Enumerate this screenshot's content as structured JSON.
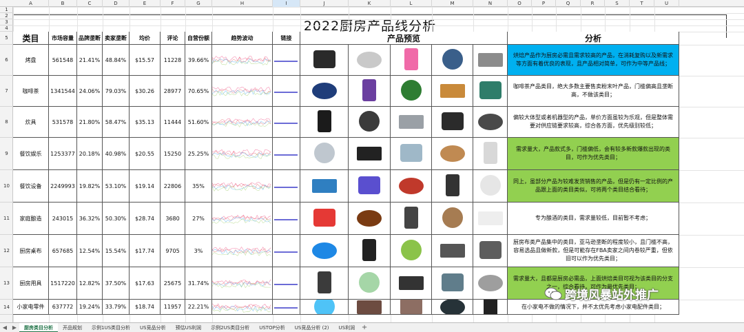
{
  "title": "2022厨房产品线分析",
  "column_letters": [
    "A",
    "B",
    "C",
    "D",
    "E",
    "F",
    "G",
    "H",
    "I",
    "J",
    "K",
    "L",
    "M",
    "N",
    "O",
    "P",
    "Q",
    "R",
    "S",
    "T",
    "U"
  ],
  "selected_column": "I",
  "row_numbers": [
    "1",
    "2",
    "3",
    "4",
    "5",
    "6",
    "7",
    "8",
    "9",
    "10",
    "11",
    "12",
    "13",
    "14"
  ],
  "headers": {
    "category": "类目",
    "market": "市场容量",
    "brand": "品牌垄断",
    "seller": "卖家垄断",
    "price": "均价",
    "reviews": "评论",
    "own_share": "自营份额",
    "trend": "趋势波动",
    "link": "链接",
    "preview": "产品预览",
    "analysis": "分析"
  },
  "rows": [
    {
      "category": "烤盘",
      "market": "561548",
      "brand": "21.41%",
      "seller": "48.84%",
      "price": "$15.57",
      "reviews": "11228",
      "own_share": "39.66%",
      "analysis": "烘焙产品作为厨房必需且需求较高的产品，在消耗复购以及新需求等方面有着优良的表现，且产品相对简单，可作为中等产品线；",
      "analysis_color": "blue"
    },
    {
      "category": "咖啡茶",
      "market": "1341544",
      "brand": "24.06%",
      "seller": "79.03%",
      "price": "$30.26",
      "reviews": "28977",
      "own_share": "70.65%",
      "analysis": "咖啡茶产品类目，绝大多数主要售卖粉末叶产品，门槛偏高且垄断高，不做该类目；",
      "analysis_color": "none"
    },
    {
      "category": "炊具",
      "market": "531578",
      "brand": "21.80%",
      "seller": "58.47%",
      "price": "$35.13",
      "reviews": "11444",
      "own_share": "51.60%",
      "analysis": "偏较大体型或者机器型的产品，单价方面虽较为乐观，但是整体需要对供应链要求较高，综合各方面，优先级别较低；",
      "analysis_color": "none"
    },
    {
      "category": "餐饮娱乐",
      "market": "1253377",
      "brand": "20.18%",
      "seller": "40.98%",
      "price": "$20.55",
      "reviews": "15250",
      "own_share": "25.25%",
      "analysis": "需求量大，产品款式多，门槛偏低，会有较多新款爆款出现的类目，可作为优先类目；",
      "analysis_color": "green"
    },
    {
      "category": "餐饮设备",
      "market": "2249993",
      "brand": "19.82%",
      "seller": "53.10%",
      "price": "$19.14",
      "reviews": "22806",
      "own_share": "35%",
      "analysis": "同上，虽部分产品为较难发货销售的产品，但是仍有一定比例的产品跟上面的类目类似，可将两个类目结合看待；",
      "analysis_color": "green"
    },
    {
      "category": "家庭酿造",
      "market": "243015",
      "brand": "36.32%",
      "seller": "50.30%",
      "price": "$28.74",
      "reviews": "3680",
      "own_share": "27%",
      "analysis": "专为酿酒的类目，需求量较低，目前暂不考虑；",
      "analysis_color": "none"
    },
    {
      "category": "厨房桌布",
      "market": "657685",
      "brand": "12.54%",
      "seller": "15.54%",
      "price": "$17.74",
      "reviews": "9705",
      "own_share": "3%",
      "analysis": "厨房布类产品集中的类目，亚马逊垄断的程度较小，且门槛不高，容易选品且做新款，但是可能存在FBA卖家之间内卷较严重，但依旧可以作为优先类目；",
      "analysis_color": "none"
    },
    {
      "category": "厨房用具",
      "market": "1517220",
      "brand": "12.82%",
      "seller": "37.50%",
      "price": "$17.63",
      "reviews": "25675",
      "own_share": "31.74%",
      "analysis": "需求量大，且都是厨房必需品，上面烘焙类目可视为该类目的分支之一，综合看待，可作为最优先类目；",
      "analysis_color": "green"
    },
    {
      "category": "小家电零件",
      "market": "637772",
      "brand": "19.24%",
      "seller": "33.79%",
      "price": "$18.74",
      "reviews": "11957",
      "own_share": "22.21%",
      "analysis": "在小家电不做的情况下，并不太优先考虑小家电配件类目；",
      "analysis_color": "none"
    }
  ],
  "product_colors": [
    [
      "#2a2a2a",
      "#c9c9c9",
      "#f06aa8",
      "#3a5f8a",
      "#8c8c8c"
    ],
    [
      "#1f3d7a",
      "#6b3fa0",
      "#2e7d32",
      "#c98a3a",
      "#2f7d6a"
    ],
    [
      "#1b1b1b",
      "#3b3b3b",
      "#9aa0a6",
      "#2b2b2b",
      "#4a4a4a"
    ],
    [
      "#bfc7cf",
      "#222222",
      "#9fb8c8",
      "#c08a52",
      "#d8d8d8"
    ],
    [
      "#2f7fc1",
      "#5a4fcf",
      "#c0392b",
      "#333333",
      "#e6e6e6"
    ],
    [
      "#e53935",
      "#7a3b12",
      "#444444",
      "#a67c52",
      "#eeeeee"
    ],
    [
      "#1e88e5",
      "#222222",
      "#8bc34a",
      "#555555",
      "#5d5d5d"
    ],
    [
      "#3b3b3b",
      "#a5d6a7",
      "#333333",
      "#607d8b",
      "#9e9e9e"
    ],
    [
      "#4fc3f7",
      "#6d4c41",
      "#8d6e63",
      "#263238",
      "#212121"
    ]
  ],
  "sheet_tabs": [
    "厨房类目分析",
    "开品规划",
    "示例1US类目分析",
    "US竞品分析",
    "预估US利润",
    "示例2US类目分析",
    "USTOP分析",
    "US竞品分析 (2)",
    "US利润"
  ],
  "active_tab": "厨房类目分析",
  "watermark": "跨境风暴站外推广"
}
